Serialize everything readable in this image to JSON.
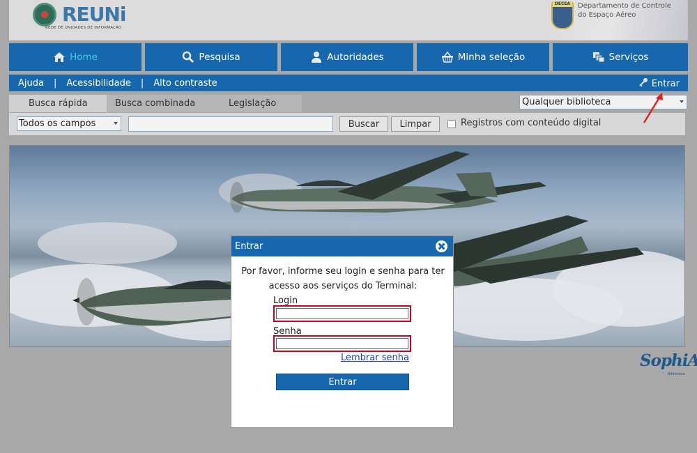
{
  "header": {
    "logo_text": "REUNi",
    "logo_tagline": "REDE DE UNIDADES DE INFORMAÇÃO",
    "org_badge": "DECEA",
    "org_name_line1": "Departamento de Controle",
    "org_name_line2": "do Espaço Aéreo"
  },
  "nav": {
    "items": [
      {
        "label": "Home",
        "icon": "home-icon"
      },
      {
        "label": "Pesquisa",
        "icon": "search-icon"
      },
      {
        "label": "Autoridades",
        "icon": "person-icon"
      },
      {
        "label": "Minha seleção",
        "icon": "basket-icon"
      },
      {
        "label": "Serviços",
        "icon": "windows-icon"
      }
    ]
  },
  "subbar": {
    "ajuda": "Ajuda",
    "sep": "|",
    "acessibilidade": "Acessibilidade",
    "alto_contraste": "Alto contraste",
    "entrar": "Entrar"
  },
  "search": {
    "tabs": [
      "Busca rápida",
      "Busca combinada",
      "Legislação"
    ],
    "library_select": "Qualquer biblioteca",
    "field_select": "Todos os campos",
    "query": "",
    "buscar": "Buscar",
    "limpar": "Limpar",
    "digital_checkbox_label": "Registros com conteúdo digital"
  },
  "footer": {
    "brand": "SophiA",
    "brand_sub": "Biblioteca"
  },
  "modal": {
    "title": "Entrar",
    "message": "Por favor, informe seu login e senha para ter acesso aos serviços do Terminal:",
    "login_label": "Login",
    "login_value": "",
    "senha_label": "Senha",
    "senha_value": "",
    "forgot_link": "Lembrar senha",
    "submit": "Entrar"
  },
  "colors": {
    "primary": "#1767ae",
    "active_tab_text": "#3fd0e0",
    "error_border": "#d0021b",
    "link": "#1a3fbf"
  }
}
